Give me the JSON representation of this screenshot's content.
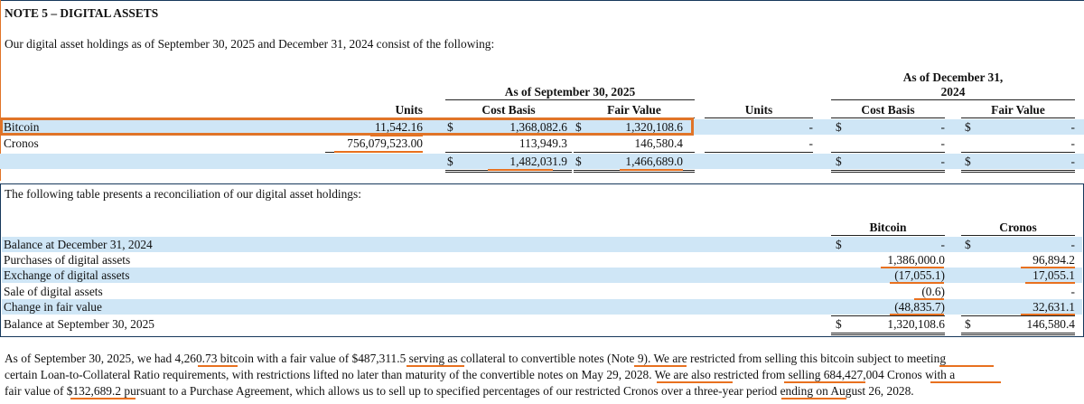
{
  "note": {
    "title": "NOTE 5 – DIGITAL ASSETS",
    "intro": "Our digital asset holdings as of September 30, 2025 and December 31, 2024 consist of the following:"
  },
  "holdings": {
    "period1_header": "As of September 30, 2025",
    "period2_header_line1": "As of December 31,",
    "period2_header_line2": "2024",
    "col_units": "Units",
    "col_cost": "Cost Basis",
    "col_fair": "Fair Value",
    "rows": [
      {
        "label": "Bitcoin",
        "units": "11,542.16",
        "cur1": "$",
        "cost": "1,368,082.6",
        "cur2": "$",
        "fair": "1,320,108.6",
        "units2": "-",
        "cur3": "$",
        "cost2": "-",
        "cur4": "$",
        "fair2": "-"
      },
      {
        "label": "Cronos",
        "units": "756,079,523.00",
        "cur1": "",
        "cost": "113,949.3",
        "cur2": "",
        "fair": "146,580.4",
        "units2": "-",
        "cur3": "",
        "cost2": "-",
        "cur4": "",
        "fair2": "-"
      },
      {
        "label": "",
        "units": "",
        "cur1": "$",
        "cost": "1,482,031.9",
        "cur2": "$",
        "fair": "1,466,689.0",
        "units2": "",
        "cur3": "$",
        "cost2": "-",
        "cur4": "$",
        "fair2": "-"
      }
    ]
  },
  "reconciliation": {
    "intro": "The following table presents a reconciliation of our digital asset holdings:",
    "col_bitcoin": "Bitcoin",
    "col_cronos": "Cronos",
    "rows": [
      {
        "label": "Balance at December 31, 2024",
        "cur1": "$",
        "btc": "-",
        "cur2": "$",
        "cro": "-"
      },
      {
        "label": "Purchases of digital assets",
        "cur1": "",
        "btc": "1,386,000.0",
        "cur2": "",
        "cro": "96,894.2"
      },
      {
        "label": "Exchange of digital assets",
        "cur1": "",
        "btc": "(17,055.1)",
        "cur2": "",
        "cro": "17,055.1"
      },
      {
        "label": "Sale of digital assets",
        "cur1": "",
        "btc": "(0.6)",
        "cur2": "",
        "cro": "-"
      },
      {
        "label": "Change in fair value",
        "cur1": "",
        "btc": "(48,835.7)",
        "cur2": "",
        "cro": "32,631.1"
      },
      {
        "label": "Balance at September 30, 2025",
        "cur1": "$",
        "btc": "1,320,108.6",
        "cur2": "$",
        "cro": "146,580.4"
      }
    ]
  },
  "footer": {
    "line1": "As of September 30, 2025, we had 4,260.73 bitcoin with a fair value of $487,311.5 serving as collateral to convertible notes (Note 9). We are restricted from selling this bitcoin subject to meeting",
    "line2": "certain Loan-to-Collateral Ratio requirements, with restrictions lifted no later than maturity of the convertible notes on May 29, 2028.  We are also restricted from selling 684,427,004 Cronos with a",
    "line3": "fair value of $132,689.2 pursuant to a Purchase Agreement, which allows us to sell up to specified percentages of our restricted Cronos over a three-year period ending on August 26, 2028."
  },
  "colors": {
    "band": "#cfe6f6",
    "highlight": "#e07428",
    "frame": "#17395c"
  }
}
